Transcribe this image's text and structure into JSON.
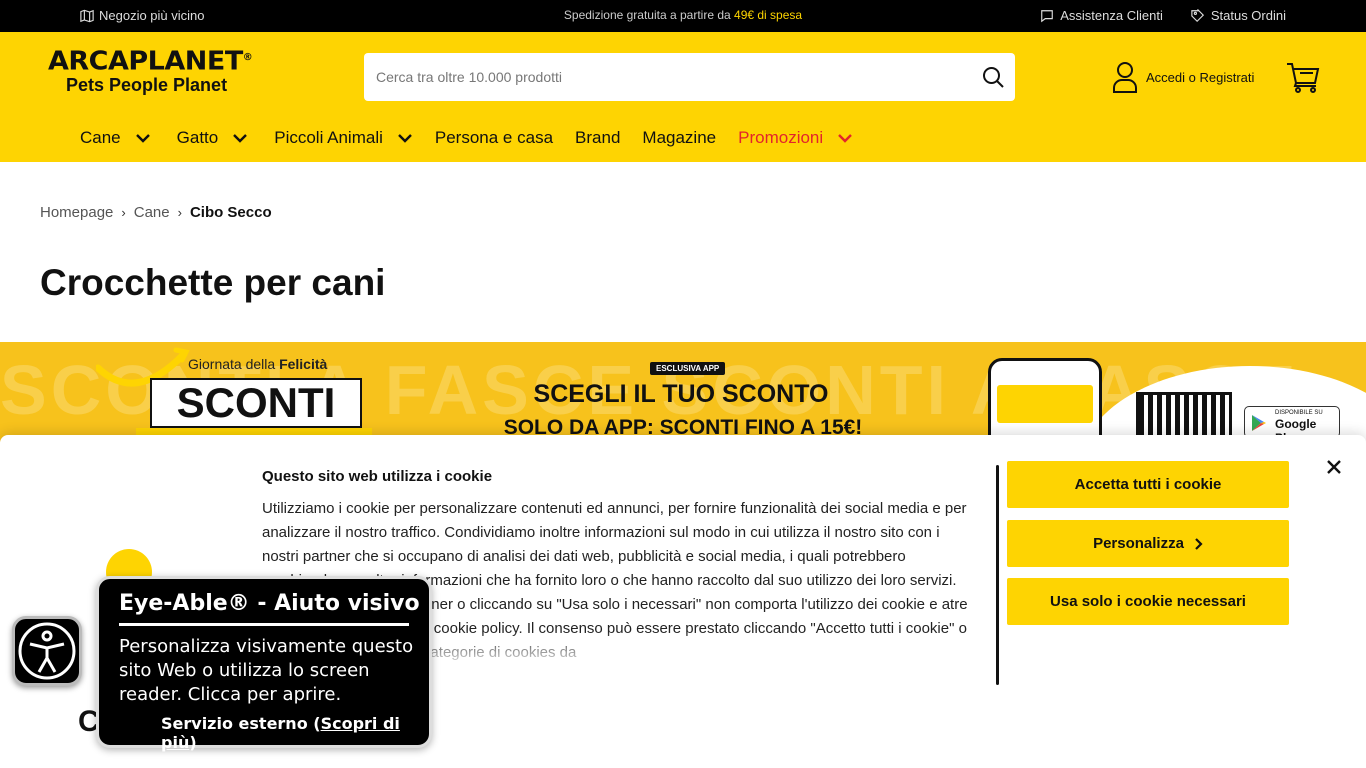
{
  "topbar": {
    "store_link": "Negozio più vicino",
    "shipping_text_pre": "Spedizione gratuita a partire da",
    "shipping_text_amount": "49€ di spesa",
    "support": "Assistenza Clienti",
    "orders": "Status Ordini"
  },
  "header": {
    "logo_word": "ARCAPLANET",
    "logo_reg": "®",
    "logo_tagline": "Pets People Planet",
    "search_placeholder": "Cerca tra oltre 10.000 prodotti",
    "account_label": "Accedi o Registrati"
  },
  "nav": {
    "items": [
      {
        "label": "Cane",
        "has_menu": true
      },
      {
        "label": "Gatto",
        "has_menu": true
      },
      {
        "label": "Piccoli Animali",
        "has_menu": true
      },
      {
        "label": "Persona e casa",
        "has_menu": false
      },
      {
        "label": "Brand",
        "has_menu": false
      },
      {
        "label": "Magazine",
        "has_menu": false
      },
      {
        "label": "Promozioni",
        "has_menu": true
      }
    ],
    "promo_color": "#e3242b"
  },
  "breadcrumb": {
    "items": [
      "Homepage",
      "Cane",
      "Cibo Secco"
    ],
    "separator": "›"
  },
  "page_title": "Crocchette per cani",
  "banner": {
    "bg_text": "SCONTI A FASCE   SCONTI A FASCE",
    "event_pre": "Giornata della",
    "event_bold": "Felicità",
    "sconti": "SCONTI",
    "badge": "ESCLUSIVA APP",
    "headline": "SCEGLI IL TUO SCONTO",
    "subheadline": "SOLO DA APP: SCONTI FINO A 15€!",
    "store_small": "DISPONIBILE SU",
    "store_name": "Google Play"
  },
  "cookie": {
    "title": "Questo sito web utilizza i cookie",
    "body": "Utilizziamo i cookie per personalizzare contenuti ed annunci, per fornire funzionalità dei social media e per analizzare il nostro traffico. Condividiamo inoltre informazioni sul modo in cui utilizza il nostro sito con i nostri partner che si occupano di analisi dei dati web, pubblicità e social media, i quali potrebbero combinarle con altre informazioni che ha fornito loro o che hanno raccolto dal suo utilizzo dei loro servizi. La mera chiusura del banner o cliccando su \"Usa solo i necessari\" non comporta l'utilizzo dei cookie e atre tecnologie. Vedi la nostra cookie policy. Il consenso può essere prestato cliccando \"Accetto tutti i cookie\" o selezionando le diverse categorie di cookies da",
    "accept_all": "Accetta tutti i cookie",
    "customize": "Personalizza",
    "necessary_only": "Usa solo i cookie necessari",
    "logo_partial": "C"
  },
  "eye_able": {
    "title": "Eye-Able® - Aiuto visivo",
    "description": "Personalizza visivamente questo sito Web o utilizza lo screen reader. Clicca per aprire.",
    "external_pre": "Servizio esterno (",
    "external_link": "Scopri di più",
    "external_post": ")"
  },
  "colors": {
    "brand_yellow": "#fed402",
    "topbar_bg": "#000000",
    "promo_red": "#e3242b"
  }
}
